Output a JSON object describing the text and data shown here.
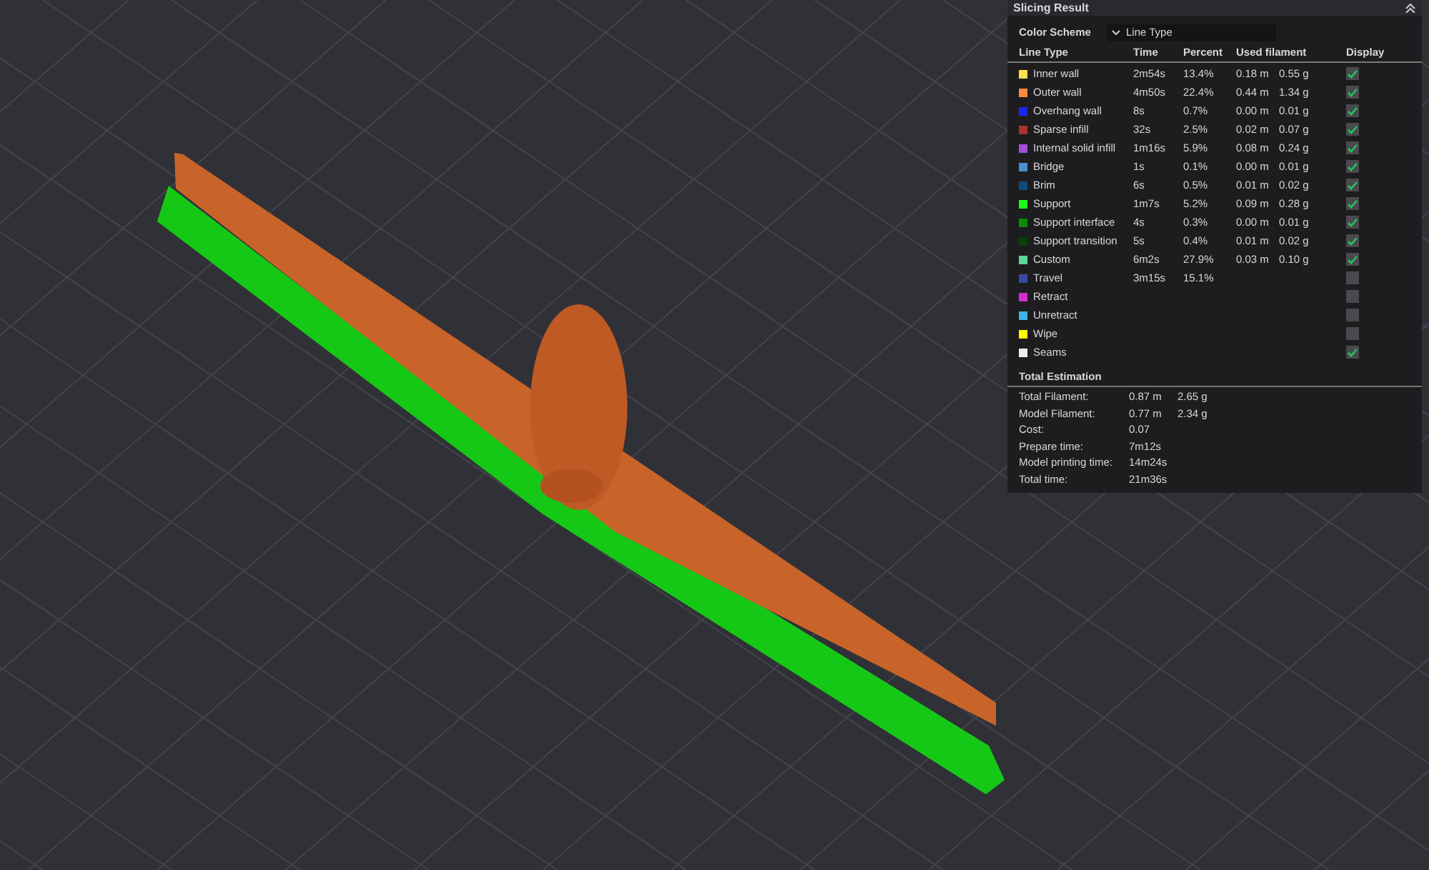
{
  "panel": {
    "title": "Slicing Result",
    "color_scheme": {
      "label": "Color Scheme",
      "value": "Line Type"
    },
    "columns": [
      "Line Type",
      "Time",
      "Percent",
      "Used filament",
      "Display"
    ],
    "rows": [
      {
        "name": "Inner wall",
        "color": "#ffdf4a",
        "time": "2m54s",
        "percent": "13.4%",
        "length": "0.18 m",
        "weight": "0.55 g",
        "checked": true
      },
      {
        "name": "Outer wall",
        "color": "#ff8a3d",
        "time": "4m50s",
        "percent": "22.4%",
        "length": "0.44 m",
        "weight": "1.34 g",
        "checked": true
      },
      {
        "name": "Overhang wall",
        "color": "#1a24ff",
        "time": "8s",
        "percent": "0.7%",
        "length": "0.00 m",
        "weight": "0.01 g",
        "checked": true
      },
      {
        "name": "Sparse infill",
        "color": "#b0302b",
        "time": "32s",
        "percent": "2.5%",
        "length": "0.02 m",
        "weight": "0.07 g",
        "checked": true
      },
      {
        "name": "Internal solid infill",
        "color": "#a04fd6",
        "time": "1m16s",
        "percent": "5.9%",
        "length": "0.08 m",
        "weight": "0.24 g",
        "checked": true
      },
      {
        "name": "Bridge",
        "color": "#4d8fd0",
        "time": "1s",
        "percent": "0.1%",
        "length": "0.00 m",
        "weight": "0.01 g",
        "checked": true
      },
      {
        "name": "Brim",
        "color": "#0d4a80",
        "time": "6s",
        "percent": "0.5%",
        "length": "0.01 m",
        "weight": "0.02 g",
        "checked": true
      },
      {
        "name": "Support",
        "color": "#1aff1a",
        "time": "1m7s",
        "percent": "5.2%",
        "length": "0.09 m",
        "weight": "0.28 g",
        "checked": true
      },
      {
        "name": "Support interface",
        "color": "#0a8a0a",
        "time": "4s",
        "percent": "0.3%",
        "length": "0.00 m",
        "weight": "0.01 g",
        "checked": true
      },
      {
        "name": "Support transition",
        "color": "#0a400a",
        "time": "5s",
        "percent": "0.4%",
        "length": "0.01 m",
        "weight": "0.02 g",
        "checked": true
      },
      {
        "name": "Custom",
        "color": "#5ed69a",
        "time": "6m2s",
        "percent": "27.9%",
        "length": "0.03 m",
        "weight": "0.10 g",
        "checked": true
      },
      {
        "name": "Travel",
        "color": "#3a48a8",
        "time": "3m15s",
        "percent": "15.1%",
        "checked": false
      },
      {
        "name": "Retract",
        "color": "#d02fd0",
        "checked": false
      },
      {
        "name": "Unretract",
        "color": "#40b4e6",
        "checked": false
      },
      {
        "name": "Wipe",
        "color": "#ffff00",
        "checked": false
      },
      {
        "name": "Seams",
        "color": "#eeeeee",
        "checked": true
      }
    ],
    "total": {
      "title": "Total Estimation",
      "rows": [
        {
          "label": "Total Filament:",
          "values": [
            "0.87 m",
            "2.65 g"
          ]
        },
        {
          "label": "Model Filament:",
          "values": [
            "0.77 m",
            "2.34 g"
          ]
        },
        {
          "label": "Cost:",
          "values": [
            "0.07"
          ]
        },
        {
          "label": "Prepare time:",
          "values": [
            "7m12s"
          ]
        },
        {
          "label": "Model printing time:",
          "values": [
            "14m24s"
          ]
        },
        {
          "label": "Total time:",
          "values": [
            "21m36s"
          ]
        }
      ]
    }
  }
}
